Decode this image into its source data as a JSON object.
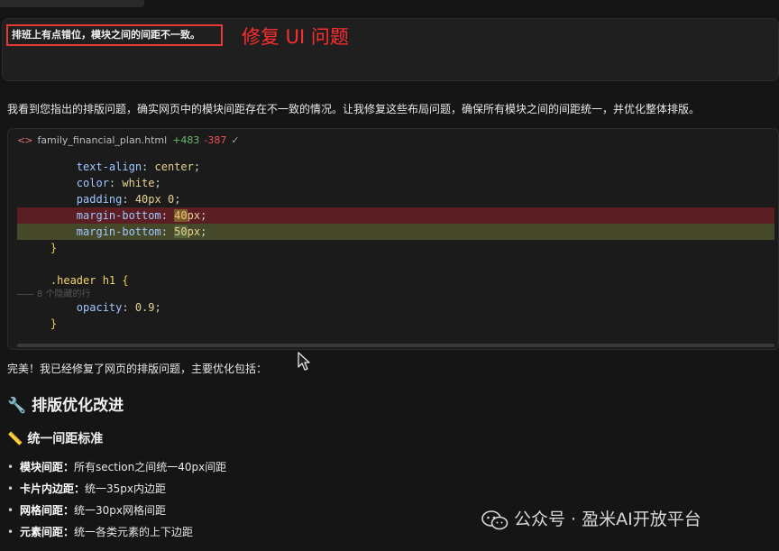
{
  "user_message": {
    "text": "排班上有点错位，模块之间的间距不一致。",
    "annotation": "修复 UI 问题"
  },
  "reply": {
    "intro": "我看到您指出的排版问题，确实网页中的模块间距存在不一致的情况。让我修复这些布局问题，确保所有模块之间的间距统一，并优化整体排版。"
  },
  "code_card": {
    "filename": "family_financial_plan.html",
    "added": "+483",
    "removed": "-387",
    "check_icon": "check-icon",
    "hidden_rows": "8 个隐藏的行",
    "lines": {
      "l1_prop": "text-align",
      "l1_val": "center",
      "l2_prop": "color",
      "l2_val": "white",
      "l3_prop": "padding",
      "l3_val": "40px 0",
      "l4_prop": "margin-bottom",
      "l4_num": "40",
      "l4_unit": "px",
      "l5_prop": "margin-bottom",
      "l5_num": "50",
      "l5_unit": "px",
      "l6": "}",
      "l7_sel": ".header h1",
      "l7_brace": "{",
      "l8_prop": "opacity",
      "l8_val": "0.9",
      "l9": "}"
    },
    "colors": {
      "deleted_bg": "#5b1e22",
      "added_bg": "#46482a"
    }
  },
  "summary": {
    "done": "完美！我已经修复了网页的排版问题，主要优化包括：",
    "heading_icon": "wrench-icon",
    "heading": "排版优化改进",
    "subheading_icon": "ruler-icon",
    "subheading": "统一间距标准",
    "items": [
      {
        "label": "模块间距：",
        "text": "所有section之间统一40px间距"
      },
      {
        "label": "卡片内边距：",
        "text": "统一35px内边距"
      },
      {
        "label": "网格间距：",
        "text": "统一30px网格间距"
      },
      {
        "label": "元素间距：",
        "text": "统一各类元素的上下边距"
      }
    ]
  },
  "watermark": {
    "icon": "wechat-icon",
    "text": "公众号 · 盈米AI开放平台"
  }
}
